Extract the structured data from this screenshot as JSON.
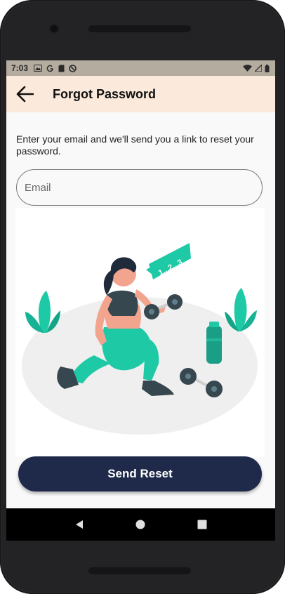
{
  "status_bar": {
    "time": "7:03",
    "left_icons": [
      "gallery-icon",
      "google-icon",
      "sd-card-icon",
      "no-disturb-icon"
    ],
    "right_icons": [
      "wifi-icon",
      "signal-icon",
      "battery-icon"
    ]
  },
  "app_bar": {
    "back_icon": "arrow-left-icon",
    "title": "Forgot Password"
  },
  "form": {
    "description": "Enter your email and we'll send you a link to reset your password.",
    "email_placeholder": "Email",
    "email_value": "",
    "submit_label": "Send Reset"
  },
  "illustration": {
    "counter_text": "1...2...3",
    "subject": "fitness-woman-lunge-with-dumbbell"
  },
  "nav_bar": {
    "buttons": [
      "back-triangle-icon",
      "home-circle-icon",
      "recents-square-icon"
    ]
  },
  "colors": {
    "app_bar_bg": "#fbe9dc",
    "status_bar_bg": "#b5aca0",
    "button_bg": "#1f2a4a",
    "accent_teal": "#1ec9a6",
    "content_bg": "#f9f9f9"
  }
}
